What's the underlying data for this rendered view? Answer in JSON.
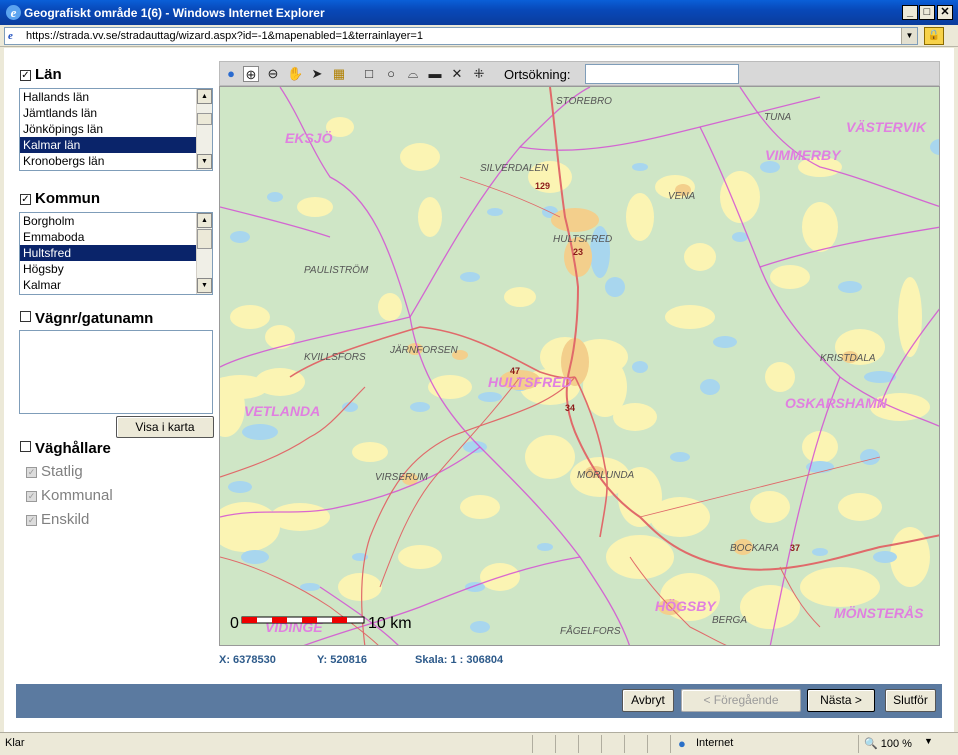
{
  "window": {
    "title": "Geografiskt område 1(6) - Windows Internet Explorer",
    "minimize": "_",
    "maximize": "□",
    "close": "✕"
  },
  "address": {
    "url": "https://strada.vv.se/stradauttag/wizard.aspx?id=-1&mapenabled=1&terrainlayer=1",
    "lock": "🔒"
  },
  "lan": {
    "label": "Län",
    "items": [
      "Hallands län",
      "Jämtlands län",
      "Jönköpings län",
      "Kalmar län",
      "Kronobergs län"
    ],
    "selected": 3
  },
  "kommun": {
    "label": "Kommun",
    "items": [
      "Borgholm",
      "Emmaboda",
      "Hultsfred",
      "Högsby",
      "Kalmar"
    ],
    "selected": 2
  },
  "vagnr": {
    "label": "Vägnr/gatunamn",
    "value": ""
  },
  "visa_button": "Visa i karta",
  "vaghallare": {
    "label": "Väghållare",
    "options": [
      "Statlig",
      "Kommunal",
      "Enskild"
    ]
  },
  "toolbar": {
    "ortsokning_label": "Ortsökning:",
    "ortsokning_value": ""
  },
  "map": {
    "places": [
      "STOREBRO",
      "TUNA",
      "VÄSTERVIK",
      "EKSJÖ",
      "VIMMERBY",
      "SILVERDALEN",
      "VENA",
      "HULTSFRED",
      "PAULISTRÖM",
      "KVILLSFORS",
      "JÄRNFORSEN",
      "KRISTDALA",
      "HULTSFRED",
      "VETLANDA",
      "OSKARSHAMN",
      "VIRSERUM",
      "MÖRLUNDA",
      "BOCKARA",
      "HÖGSBY",
      "MÖNSTERÅS",
      "BERGA",
      "FÅGELFORS",
      "VIDINGE"
    ],
    "roads": [
      "129",
      "23",
      "47",
      "34",
      "37"
    ],
    "scale_zero": "0",
    "scale_end": "10 km",
    "colors": {
      "forest": "#cfe6c6",
      "open": "#fbf4b3",
      "water": "#a8d6ee",
      "urban": "#f3cf8c",
      "road": "#e06a6a",
      "border": "#d34fd3"
    }
  },
  "coords": {
    "x": "X: 6378530",
    "y": "Y: 520816",
    "scale": "Skala: 1 : 306804"
  },
  "buttons": {
    "avbryt": "Avbryt",
    "foregaende": "< Föregående",
    "nasta": "Nästa >",
    "slutfor": "Slutför"
  },
  "status": {
    "text": "Klar",
    "zone": "Internet",
    "zoom": "🔍 100 %"
  }
}
